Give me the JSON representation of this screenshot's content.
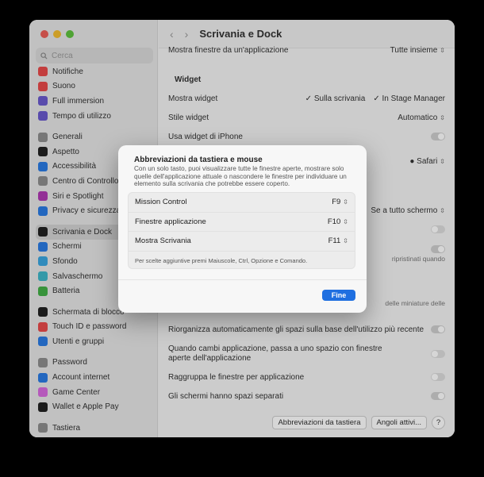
{
  "window": {
    "title": "Scrivania e Dock"
  },
  "sidebar": {
    "search_placeholder": "Cerca",
    "groups": [
      [
        {
          "label": "Notifiche",
          "icon": "bell-icon",
          "color": "#e94b4b"
        },
        {
          "label": "Suono",
          "icon": "speaker-icon",
          "color": "#e94b4b"
        },
        {
          "label": "Full immersion",
          "icon": "moon-icon",
          "color": "#6a5acd"
        },
        {
          "label": "Tempo di utilizzo",
          "icon": "hourglass-icon",
          "color": "#6a5acd"
        }
      ],
      [
        {
          "label": "Generali",
          "icon": "gear-icon",
          "color": "#8e8e8e"
        },
        {
          "label": "Aspetto",
          "icon": "appearance-icon",
          "color": "#222222"
        },
        {
          "label": "Accessibilità",
          "icon": "accessibility-icon",
          "color": "#2a7be4"
        },
        {
          "label": "Centro di Controllo",
          "icon": "control-center-icon",
          "color": "#8e8e8e"
        },
        {
          "label": "Siri e Spotlight",
          "icon": "siri-icon",
          "color": "#b03ab3"
        },
        {
          "label": "Privacy e sicurezza",
          "icon": "hand-icon",
          "color": "#2a7be4"
        }
      ],
      [
        {
          "label": "Scrivania e Dock",
          "icon": "dock-icon",
          "color": "#222222",
          "active": true
        },
        {
          "label": "Schermi",
          "icon": "display-icon",
          "color": "#2a7be4"
        },
        {
          "label": "Sfondo",
          "icon": "wallpaper-icon",
          "color": "#3aa6e0"
        },
        {
          "label": "Salvaschermo",
          "icon": "screensaver-icon",
          "color": "#3fb7c9"
        },
        {
          "label": "Batteria",
          "icon": "battery-icon",
          "color": "#43b047"
        }
      ],
      [
        {
          "label": "Schermata di blocco",
          "icon": "lock-screen-icon",
          "color": "#222222"
        },
        {
          "label": "Touch ID e password",
          "icon": "fingerprint-icon",
          "color": "#e94b4b"
        },
        {
          "label": "Utenti e gruppi",
          "icon": "users-icon",
          "color": "#2a7be4"
        }
      ],
      [
        {
          "label": "Password",
          "icon": "key-icon",
          "color": "#8e8e8e"
        },
        {
          "label": "Account internet",
          "icon": "at-icon",
          "color": "#2a7be4"
        },
        {
          "label": "Game Center",
          "icon": "game-center-icon",
          "color": "#d86adf"
        },
        {
          "label": "Wallet e Apple Pay",
          "icon": "wallet-icon",
          "color": "#222222"
        }
      ],
      [
        {
          "label": "Tastiera",
          "icon": "keyboard-icon",
          "color": "#8e8e8e"
        }
      ]
    ]
  },
  "main": {
    "row_windows_label": "Mostra finestre da un'applicazione",
    "row_windows_value": "Tutte insieme",
    "widget_title": "Widget",
    "show_widget_label": "Mostra widget",
    "show_widget_desktop": "Sulla scrivania",
    "show_widget_stage": "In Stage Manager",
    "widget_style_label": "Stile widget",
    "widget_style_value": "Automatico",
    "iphone_widget_label": "Usa widget di iPhone",
    "browser_value": "Safari",
    "fullscreen_value": "Se a tutto schermo",
    "restore_text": "ripristinati quando",
    "mini_text": "delle miniature delle",
    "rearrange_label": "Riorganizza automaticamente gli spazi sulla base dell'utilizzo più recente",
    "switch_app_label": "Quando cambi applicazione, passa a uno spazio con finestre aperte dell'applicazione",
    "group_windows_label": "Raggruppa le finestre per applicazione",
    "separate_spaces_label": "Gli schermi hanno spazi separati",
    "shortcuts_button": "Abbreviazioni da tastiera",
    "hot_corners_button": "Angoli attivi...",
    "help_button": "?"
  },
  "modal": {
    "title": "Abbreviazioni da tastiera e mouse",
    "description": "Con un solo tasto, puoi visualizzare tutte le finestre aperte, mostrare solo quelle dell'applicazione attuale o nascondere le finestre per individuare un elemento sulla scrivania che potrebbe essere coperto.",
    "rows": [
      {
        "label": "Mission Control",
        "value": "F9"
      },
      {
        "label": "Finestre applicazione",
        "value": "F10"
      },
      {
        "label": "Mostra Scrivania",
        "value": "F11"
      }
    ],
    "note": "Per scelte aggiuntive premi Maiuscole, Ctrl, Opzione e Comando.",
    "done_button": "Fine"
  }
}
